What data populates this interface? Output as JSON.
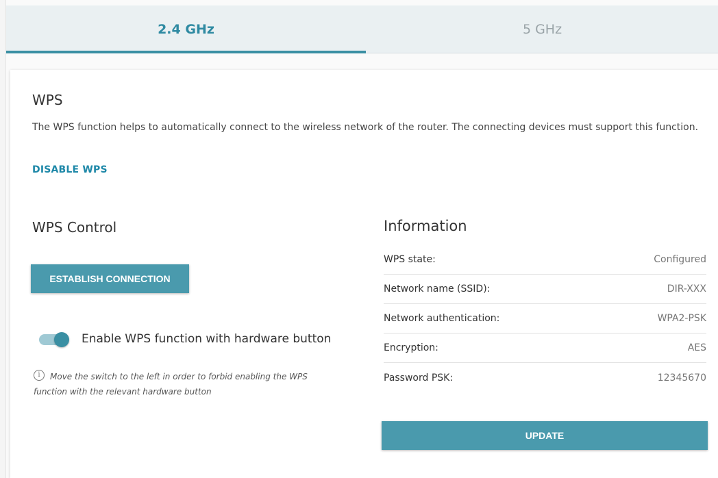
{
  "tabs": [
    {
      "label": "2.4 GHz",
      "active": true
    },
    {
      "label": "5 GHz",
      "active": false
    }
  ],
  "wps": {
    "title": "WPS",
    "description": "The WPS function helps to automatically connect to the wireless network of the router. The connecting devices must support this function.",
    "disable_label": "DISABLE WPS"
  },
  "control": {
    "title": "WPS Control",
    "establish_label": "ESTABLISH CONNECTION",
    "switch_label": "Enable WPS function with hardware button",
    "switch_on": true,
    "hint_icon": "info-icon",
    "hint": "Move the switch to the left in order to forbid enabling the WPS function with the relevant hardware button"
  },
  "info": {
    "title": "Information",
    "rows": [
      {
        "key": "WPS state:",
        "value": "Configured"
      },
      {
        "key": "Network name (SSID):",
        "value": "DIR-XXX"
      },
      {
        "key": "Network authentication:",
        "value": "WPA2-PSK"
      },
      {
        "key": "Encryption:",
        "value": "AES"
      },
      {
        "key": "Password PSK:",
        "value": "12345670"
      }
    ],
    "update_label": "UPDATE"
  },
  "colors": {
    "accent": "#3a8fa3",
    "button": "#4a9aad",
    "link": "#1e88a8"
  }
}
